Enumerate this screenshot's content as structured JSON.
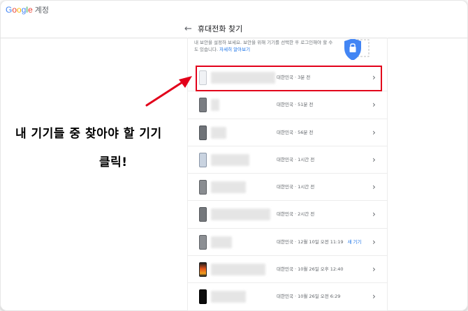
{
  "brand": {
    "logo_text": "Google",
    "service_label": "계정"
  },
  "header": {
    "title": "휴대전화 찾기"
  },
  "info": {
    "text": "내 보안을 설정하 보세요. 보안을 위해 기기를 선택한 후 로그인해야 할 수도 있습니다.",
    "link_label": "자세히 알아보기"
  },
  "colors": {
    "accent": "#1a73e8",
    "highlight": "#e2001a",
    "google_blue": "#4285f4",
    "google_red": "#ea4335",
    "google_yellow": "#fbbc05",
    "google_green": "#34a853"
  },
  "devices": [
    {
      "status": "대한민국 · 3분 전",
      "new_label": "",
      "icon": "phone-light-icon"
    },
    {
      "status": "대한민국 · 51분 전",
      "new_label": "",
      "icon": "phone-dark-icon"
    },
    {
      "status": "대한민국 · 56분 전",
      "new_label": "",
      "icon": "phone-dark-icon"
    },
    {
      "status": "대한민국 · 1시간 전",
      "new_label": "",
      "icon": "phone-blue-icon"
    },
    {
      "status": "대한민국 · 1시간 전",
      "new_label": "",
      "icon": "phone-dark-icon"
    },
    {
      "status": "대한민국 · 2시간 전",
      "new_label": "",
      "icon": "phone-dark-icon"
    },
    {
      "status": "대한민국 · 12월 10일 오전 11:19",
      "new_label": "새 기기",
      "icon": "phone-dark-icon"
    },
    {
      "status": "대한민국 · 10월 26일 오후 12:40",
      "new_label": "",
      "icon": "phone-orange-icon"
    },
    {
      "status": "대한민국 · 10월 26일 오전 6:29",
      "new_label": "",
      "icon": "phone-black-icon"
    }
  ],
  "annotation": {
    "line1": "내 기기들 중 찾아야 할 기기",
    "line2": "클릭!"
  }
}
